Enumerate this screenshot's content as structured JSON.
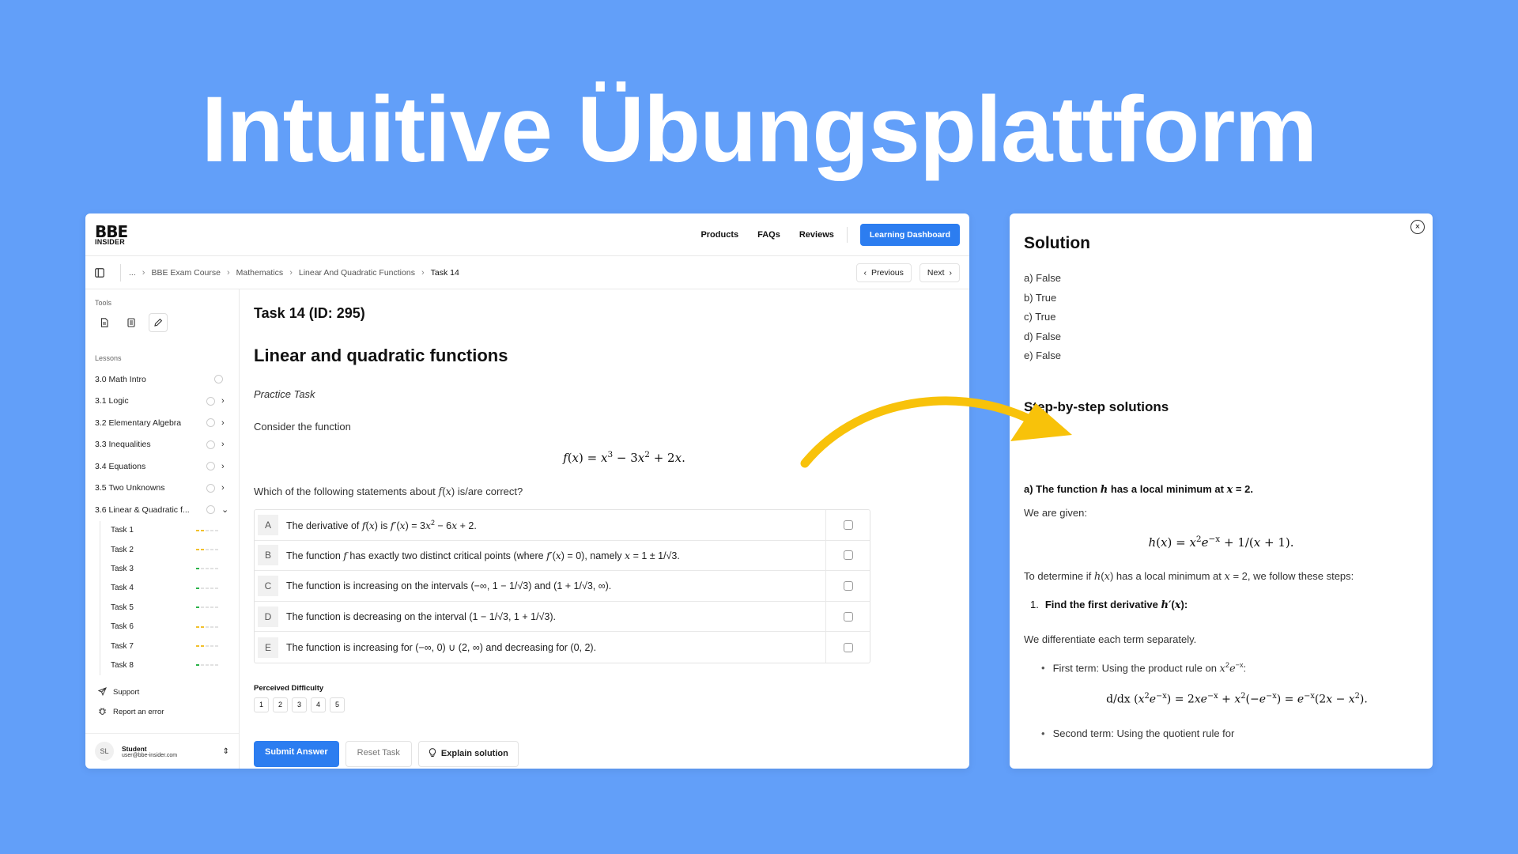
{
  "hero": {
    "title": "Intuitive Übungsplattform"
  },
  "header": {
    "logo_line1": "BBE",
    "logo_line2": "INSIDER",
    "nav": [
      "Products",
      "FAQs",
      "Reviews"
    ],
    "dashboard_button": "Learning Dashboard"
  },
  "breadcrumb": {
    "items": [
      "...",
      "BBE Exam Course",
      "Mathematics",
      "Linear And Quadratic Functions",
      "Task 14"
    ],
    "previous": "Previous",
    "next": "Next"
  },
  "sidebar": {
    "tools_label": "Tools",
    "lessons_label": "Lessons",
    "lessons": [
      {
        "name": "3.0 Math Intro"
      },
      {
        "name": "3.1 Logic"
      },
      {
        "name": "3.2 Elementary Algebra"
      },
      {
        "name": "3.3 Inequalities"
      },
      {
        "name": "3.4 Equations"
      },
      {
        "name": "3.5 Two Unknowns"
      },
      {
        "name": "3.6 Linear & Quadratic f..."
      }
    ],
    "tasks": [
      {
        "name": "Task 1",
        "color": "#f2c12e",
        "level": 2
      },
      {
        "name": "Task 2",
        "color": "#f2c12e",
        "level": 2
      },
      {
        "name": "Task 3",
        "color": "#2cb34a",
        "level": 1
      },
      {
        "name": "Task 4",
        "color": "#2cb34a",
        "level": 1
      },
      {
        "name": "Task 5",
        "color": "#2cb34a",
        "level": 1
      },
      {
        "name": "Task 6",
        "color": "#f2c12e",
        "level": 2
      },
      {
        "name": "Task 7",
        "color": "#f2c12e",
        "level": 2
      },
      {
        "name": "Task 8",
        "color": "#2cb34a",
        "level": 1
      }
    ],
    "support": "Support",
    "report": "Report an error",
    "user_initials": "SL",
    "user_name": "Student",
    "user_email": "user@bbe-insider.com"
  },
  "main": {
    "task_title": "Task 14 (ID: 295)",
    "heading": "Linear and quadratic functions",
    "practice": "Practice Task",
    "consider": "Consider the function",
    "question_pre": "Which of the following statements about",
    "question_post": "is/are correct?",
    "options": [
      {
        "letter": "A"
      },
      {
        "letter": "B"
      },
      {
        "letter": "C"
      },
      {
        "letter": "D"
      },
      {
        "letter": "E"
      }
    ],
    "difficulty_label": "Perceived Difficulty",
    "difficulty": [
      "1",
      "2",
      "3",
      "4",
      "5"
    ],
    "submit": "Submit Answer",
    "reset": "Reset Task",
    "explain": "Explain solution"
  },
  "solution": {
    "title": "Solution",
    "answers": [
      "a) False",
      "b) True",
      "c) True",
      "d) False",
      "e) False"
    ],
    "steps_title": "Step-by-step solutions",
    "a_title_pre": "a) The function",
    "a_title_mid": "has a local minimum at",
    "given": "We are given:",
    "determine_pre": "To determine if",
    "determine_mid": "has a local minimum at",
    "determine_post": ", we follow these steps:",
    "step1_num": "1.",
    "step1_text": "Find the first derivative",
    "differentiate": "We differentiate each term separately.",
    "first_term": "First term: Using the product rule on",
    "second_term": "Second term: Using the quotient rule for"
  },
  "colors": {
    "background": "#629ff9",
    "accent": "#2c7df0",
    "arrow": "#f8c20a"
  }
}
